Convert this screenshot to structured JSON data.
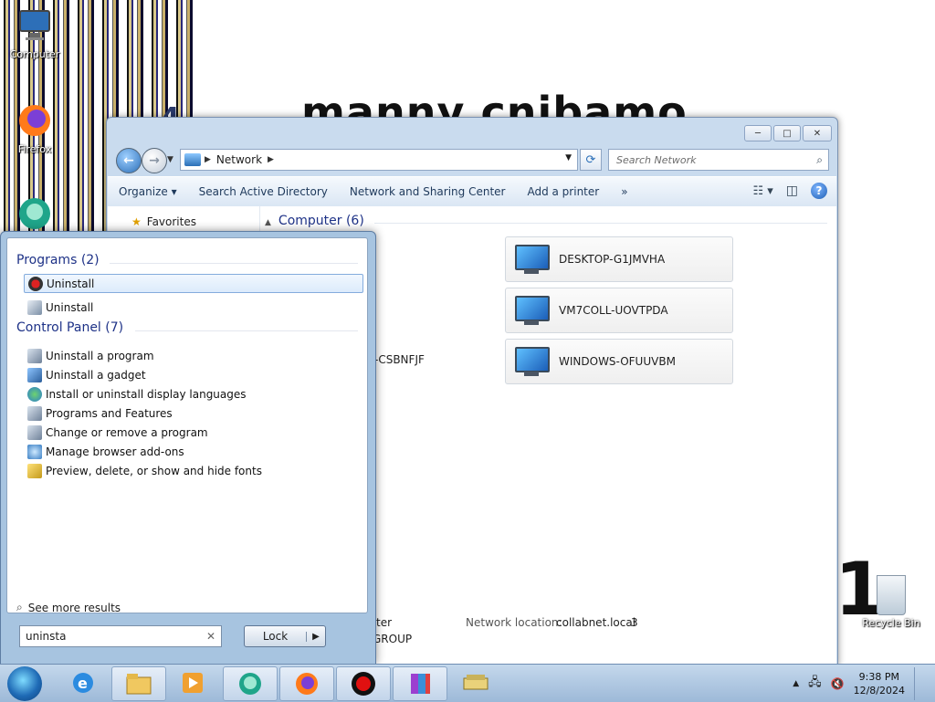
{
  "desktop": {
    "wallpaper_text": "manny cnibamo",
    "wallpaper_digit": "1",
    "icons": [
      {
        "label": "Computer",
        "icon": "computer-icon"
      },
      {
        "label": "Firefox",
        "icon": "firefox-icon"
      },
      {
        "label": "Recycle Bin",
        "icon": "recycle-bin-icon"
      }
    ]
  },
  "explorer": {
    "address": {
      "root_icon": "network-icon",
      "crumb": "Network"
    },
    "search_placeholder": "Search Network",
    "toolbar": {
      "organize": "Organize",
      "search_ad": "Search Active Directory",
      "network_center": "Network and Sharing Center",
      "add_printer": "Add a printer",
      "more": "»"
    },
    "nav": {
      "favorites": "Favorites"
    },
    "group": {
      "title": "Computer (6)"
    },
    "computers": [
      "DESKTOP-G1JMVHA",
      "VM7COLL-UOVTPDA",
      "WINDOWS-OFUUVBM"
    ],
    "partial_item": "-CSBNFJF",
    "details": {
      "left_top": "ter",
      "left_bottom": "GROUP",
      "network_location_label": "Network location:",
      "network_location_value": "collabnet.local",
      "network_location_extra": "3"
    }
  },
  "start_menu": {
    "programs_header": "Programs (2)",
    "programs": [
      {
        "label": "Uninstall",
        "icon": "uninstall-app-icon",
        "selected": true
      },
      {
        "label": "Uninstall",
        "icon": "uninstall-app-icon-2",
        "selected": false
      }
    ],
    "control_panel_header": "Control Panel (7)",
    "control_panel": [
      {
        "label": "Uninstall a program",
        "icon": "programs-icon"
      },
      {
        "label": "Uninstall a gadget",
        "icon": "gadget-icon"
      },
      {
        "label": "Install or uninstall display languages",
        "icon": "globe-icon"
      },
      {
        "label": "Programs and Features",
        "icon": "programs-icon"
      },
      {
        "label": "Change or remove a program",
        "icon": "programs-icon"
      },
      {
        "label": "Manage browser add-ons",
        "icon": "browser-icon"
      },
      {
        "label": "Preview, delete, or show and hide fonts",
        "icon": "fonts-icon"
      }
    ],
    "see_more": "See more results",
    "search_value": "uninsta",
    "clear": "✕",
    "lock_label": "Lock",
    "lock_arrow": "▶"
  },
  "taskbar": {
    "apps": [
      "start-orb",
      "internet-explorer-icon",
      "file-explorer-icon",
      "media-player-icon",
      "chat-app-icon",
      "firefox-icon",
      "record-icon",
      "archive-icon",
      "scanner-icon"
    ],
    "clock_time": "9:38 PM",
    "clock_date": "12/8/2024"
  },
  "colors": {
    "accent": "#1e3287",
    "selection_border": "#84acdd",
    "taskbar": "#b0c9e3"
  }
}
